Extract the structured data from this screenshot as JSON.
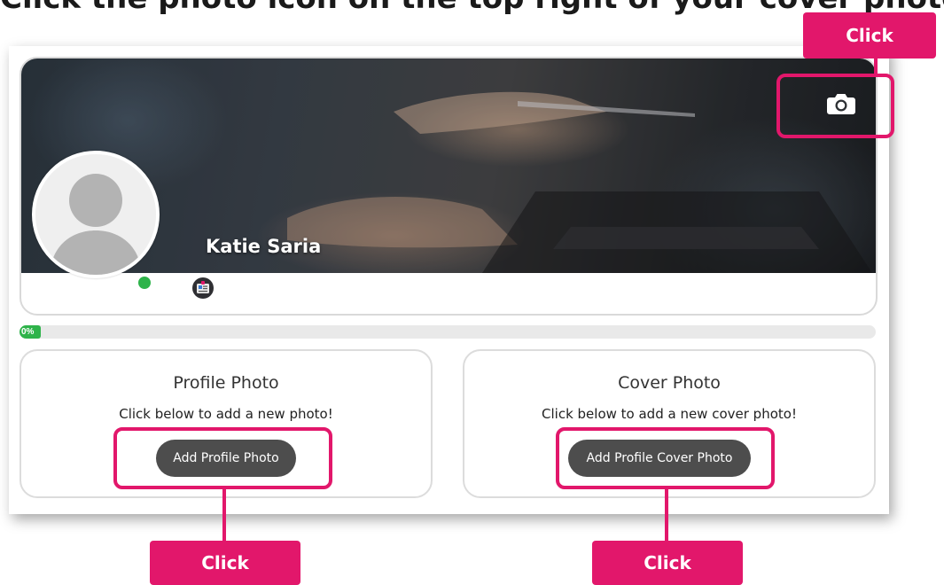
{
  "instruction": {
    "headline": "Click the photo icon on the top right of your cover photo."
  },
  "profile": {
    "name": "Katie Saria",
    "online_status_color": "#2eb34a"
  },
  "progress": {
    "label": "0%",
    "value_percent": 0
  },
  "profile_photo_card": {
    "title": "Profile Photo",
    "subtitle": "Click below to add a new photo!",
    "button_label": "Add Profile Photo"
  },
  "cover_photo_card": {
    "title": "Cover Photo",
    "subtitle": "Click below to add a new cover photo!",
    "button_label": "Add Profile Cover Photo"
  },
  "callouts": {
    "top_label": "Click",
    "left_label": "Click",
    "right_label": "Click"
  },
  "colors": {
    "highlight": "#e2176b",
    "button_bg": "#4d4d4d",
    "progress_green": "#2eb34a"
  },
  "icons": {
    "cover_camera": "camera-icon",
    "badge": "id-badge-icon",
    "avatar": "default-avatar-icon"
  }
}
